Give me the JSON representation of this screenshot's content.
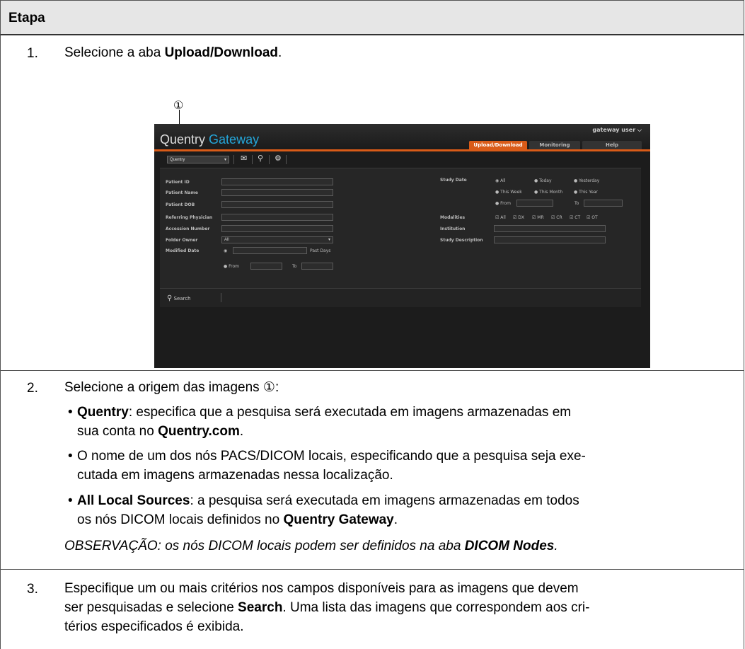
{
  "table": {
    "header": "Etapa",
    "steps": [
      {
        "number": "1.",
        "text_pre": "Selecione a aba ",
        "text_bold": "Upload/Download",
        "text_post": "."
      },
      {
        "number": "2.",
        "text": "Selecione a origem das imagens ①:"
      },
      {
        "number": "3.",
        "line1_pre": "Especifique um ou mais critérios nos campos disponíveis para as imagens que devem",
        "line2_pre": "ser pesquisadas e selecione ",
        "line2_bold": "Search",
        "line2_post": ". Uma lista das imagens que correspondem aos cri-",
        "line3": "térios especificados é exibida."
      }
    ],
    "bullets": [
      {
        "bold": "Quentry",
        "text": ": especifica que a pesquisa será executada em imagens armazenadas em",
        "line2_pre": "sua conta no ",
        "line2_bold": "Quentry.com",
        "line2_post": "."
      },
      {
        "text1": "O nome de um dos nós PACS/DICOM locais, especificando que a pesquisa seja exe-",
        "text2": "cutada em imagens armazenadas nessa localização."
      },
      {
        "bold": "All Local Sources",
        "text": ": a pesquisa será executada em imagens armazenadas em todos",
        "line2_pre": "os nós DICOM locais definidos no ",
        "line2_bold": "Quentry Gateway",
        "line2_post": "."
      }
    ],
    "note_pre": "OBSERVAÇÃO: os nós DICOM locais podem ser definidos na aba ",
    "note_bold": "DICOM Nodes",
    "note_post": ".",
    "callout": "①"
  },
  "app": {
    "logo_a": "Quentry",
    "logo_b": "Gateway",
    "user": "gateway user ⌵",
    "tabs": [
      "Upload/Download",
      "Monitoring",
      "Help"
    ],
    "source_select": "Quentry",
    "fields_left": [
      "Patient ID",
      "Patient Name",
      "Patient DOB",
      "Referring Physician",
      "Accession Number",
      "Folder Owner",
      "Modified Date"
    ],
    "folder_owner_value": "All",
    "past_days": "Past Days",
    "from": "From",
    "to": "To",
    "study_date_label": "Study Date",
    "study_date_opts": [
      "All",
      "Today",
      "Yesterday",
      "This Week",
      "This Month",
      "This Year",
      "From",
      "To"
    ],
    "modalities_label": "Modalities",
    "modalities": [
      "All",
      "DX",
      "MR",
      "CR",
      "CT",
      "OT"
    ],
    "institution_label": "Institution",
    "study_description_label": "Study Description",
    "search_label": "Search"
  }
}
